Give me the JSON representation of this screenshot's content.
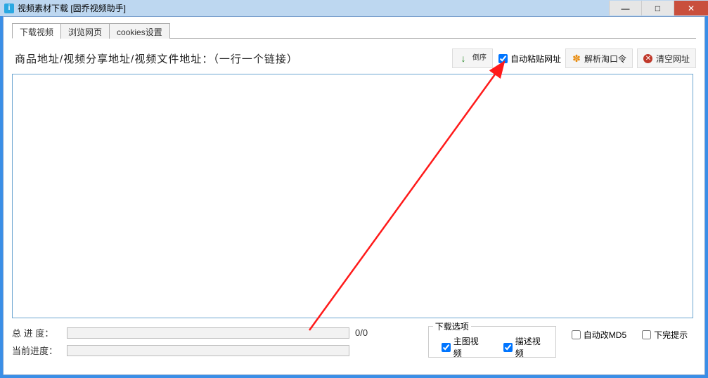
{
  "window": {
    "title": "视频素材下载 [固乔视频助手]"
  },
  "win_controls": {
    "min": "—",
    "max": "□",
    "close": "✕"
  },
  "tabs": {
    "download": "下载视频",
    "browse": "浏览网页",
    "cookies": "cookies设置"
  },
  "toolbar": {
    "address_label": "商品地址/视频分享地址/视频文件地址：（一行一个链接）",
    "reverse_btn": "倒序",
    "auto_paste_label": "自动粘贴网址",
    "parse_btn": "解析淘口令",
    "clear_btn": "清空网址"
  },
  "textarea_value": "",
  "progress": {
    "total_label": "总 进 度：",
    "total_text": "0/0",
    "current_label": "当前进度："
  },
  "dl_options": {
    "legend": "下载选项",
    "main_video": "主图视频",
    "desc_video": "描述视频"
  },
  "right_opts": {
    "auto_md5": "自动改MD5",
    "done_tip": "下完提示"
  }
}
